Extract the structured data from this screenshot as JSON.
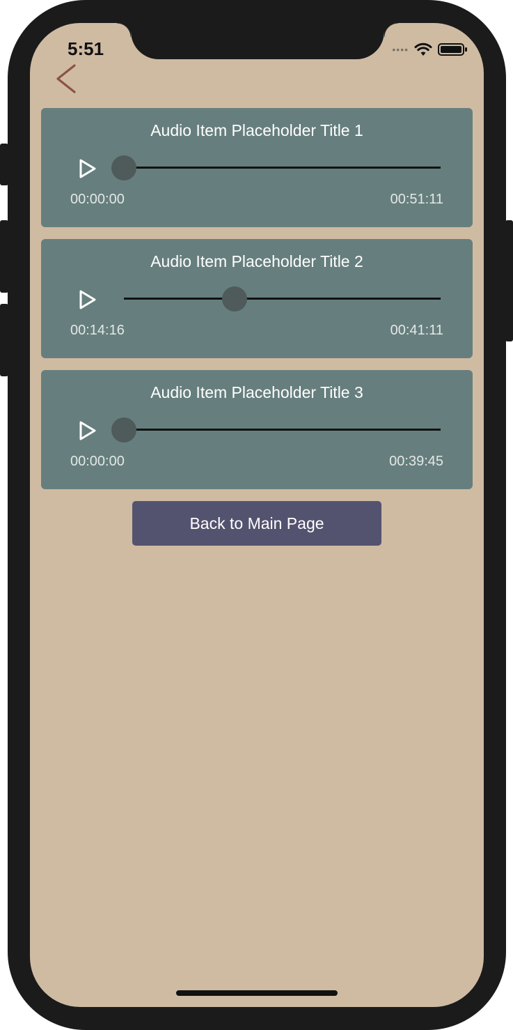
{
  "status_bar": {
    "time": "5:51",
    "signal_icon": "cellular-dots-icon",
    "wifi_icon": "wifi-icon",
    "battery_icon": "battery-icon"
  },
  "nav": {
    "back_icon": "chevron-left-icon"
  },
  "colors": {
    "background": "#cfbba2",
    "card": "#667f7e",
    "button": "#54536f",
    "back_chevron": "#8a5345"
  },
  "audio_items": [
    {
      "title": "Audio Item Placeholder Title 1",
      "current": "00:00:00",
      "total": "00:51:11",
      "progress": 0.0
    },
    {
      "title": "Audio Item Placeholder Title 2",
      "current": "00:14:16",
      "total": "00:41:11",
      "progress": 0.35
    },
    {
      "title": "Audio Item Placeholder Title 3",
      "current": "00:00:00",
      "total": "00:39:45",
      "progress": 0.0
    }
  ],
  "back_button": {
    "label": "Back to Main Page"
  }
}
